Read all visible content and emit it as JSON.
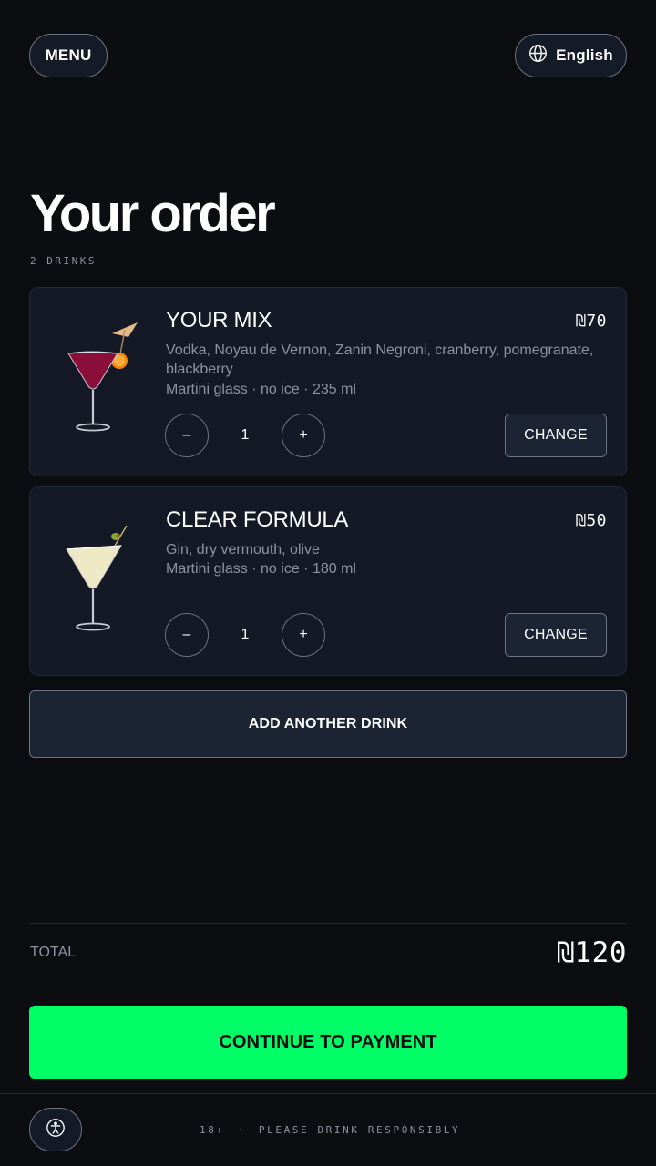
{
  "header": {
    "menu_label": "MENU",
    "language_label": "English"
  },
  "page": {
    "title": "Your order",
    "count_label": "2 DRINKS"
  },
  "items": [
    {
      "name": "YOUR MIX",
      "price": "₪70",
      "ingredients": "Vodka, Noyau de Vernon, Zanin Negroni, cranberry, pomegranate, blackberry",
      "details": "Martini glass · no ice · 235 ml",
      "quantity": "1",
      "minus_label": "–",
      "plus_label": "+",
      "change_label": "CHANGE",
      "drink_color": "#8a0f3a",
      "image": "cocktail-umbrella-orange"
    },
    {
      "name": "CLEAR FORMULA",
      "price": "₪50",
      "ingredients": "Gin, dry vermouth, olive",
      "details": "Martini glass · no ice · 180 ml",
      "quantity": "1",
      "minus_label": "–",
      "plus_label": "+",
      "change_label": "CHANGE",
      "drink_color": "#efe8c4",
      "image": "martini-olive"
    }
  ],
  "add_button_label": "ADD ANOTHER DRINK",
  "total": {
    "label": "TOTAL",
    "value": "₪120"
  },
  "pay_button_label": "CONTINUE TO PAYMENT",
  "footer": {
    "age": "18+",
    "separator": "·",
    "notice": "PLEASE DRINK RESPONSIBLY"
  },
  "colors": {
    "background": "#0b0d11",
    "card": "#141925",
    "accent": "#00ff66",
    "muted": "#8d93a0"
  }
}
